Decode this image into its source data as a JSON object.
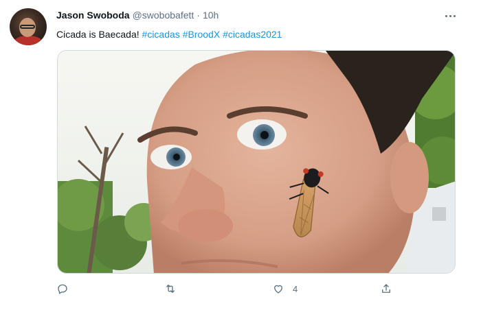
{
  "tweet": {
    "author_name": "Jason Swoboda",
    "handle": "@swobobafett",
    "separator": "·",
    "time": "10h",
    "text_plain": "Cicada is Baecada! ",
    "hashtags": [
      "#cicadas",
      "#BroodX",
      "#cicadas2021"
    ],
    "like_count": "4"
  },
  "icons": {
    "more": "more-horizontal-icon",
    "reply": "reply-icon",
    "retweet": "retweet-icon",
    "like": "heart-icon",
    "share": "share-icon"
  },
  "colors": {
    "hashtag": "#1b95e0",
    "secondary_text": "#5b7083"
  }
}
